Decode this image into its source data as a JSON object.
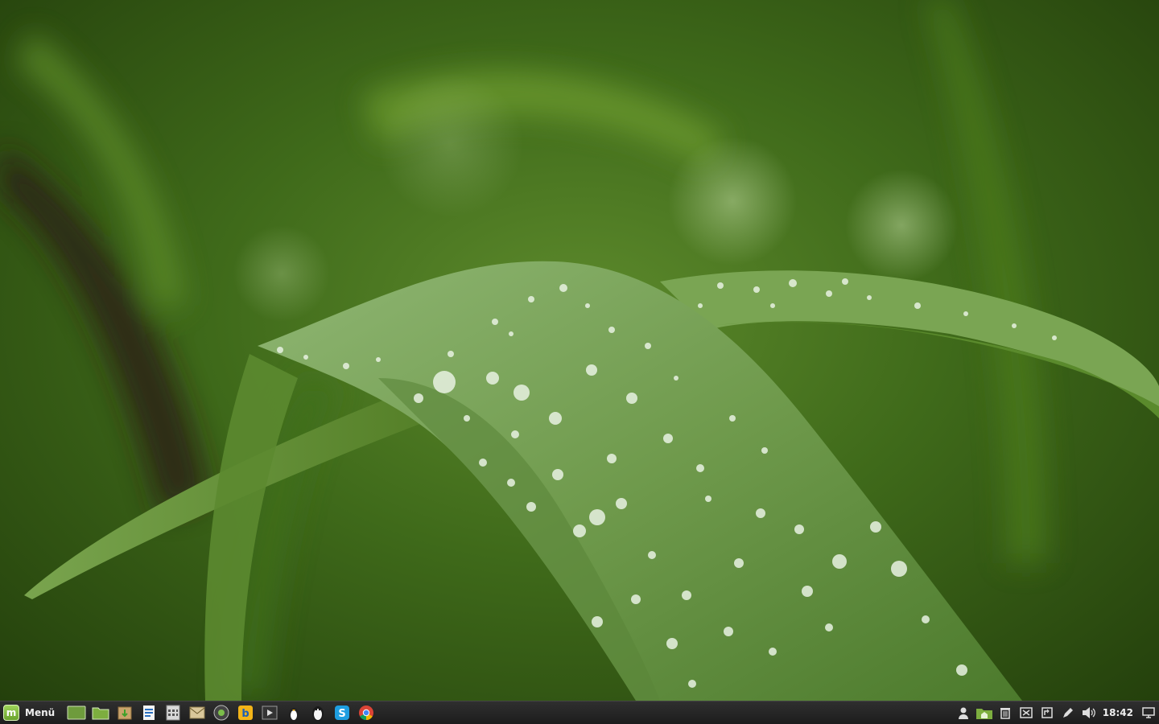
{
  "desktop": {
    "wallpaper": "green-leaf-with-water-droplets"
  },
  "panel": {
    "menu_label": "Menü",
    "clock": "18:42",
    "launchers": [
      {
        "name": "show-desktop-icon"
      },
      {
        "name": "files-icon"
      },
      {
        "name": "package-installer-icon"
      },
      {
        "name": "writer-document-icon"
      },
      {
        "name": "calculator-icon"
      },
      {
        "name": "mail-client-icon"
      },
      {
        "name": "screenshot-icon"
      },
      {
        "name": "b-app-icon"
      },
      {
        "name": "media-player-icon"
      },
      {
        "name": "penguin-game-icon"
      },
      {
        "name": "penguin-chat-icon"
      },
      {
        "name": "skype-icon"
      },
      {
        "name": "chrome-icon"
      }
    ],
    "tray": [
      {
        "name": "user-icon"
      },
      {
        "name": "home-folder-icon"
      },
      {
        "name": "trash-icon"
      },
      {
        "name": "close-window-icon"
      },
      {
        "name": "network-icon"
      },
      {
        "name": "pen-tool-icon"
      },
      {
        "name": "volume-icon"
      }
    ],
    "colors": {
      "panel_bg": "#262626",
      "mint_green": "#87c040",
      "text": "#f0f0f0"
    }
  }
}
